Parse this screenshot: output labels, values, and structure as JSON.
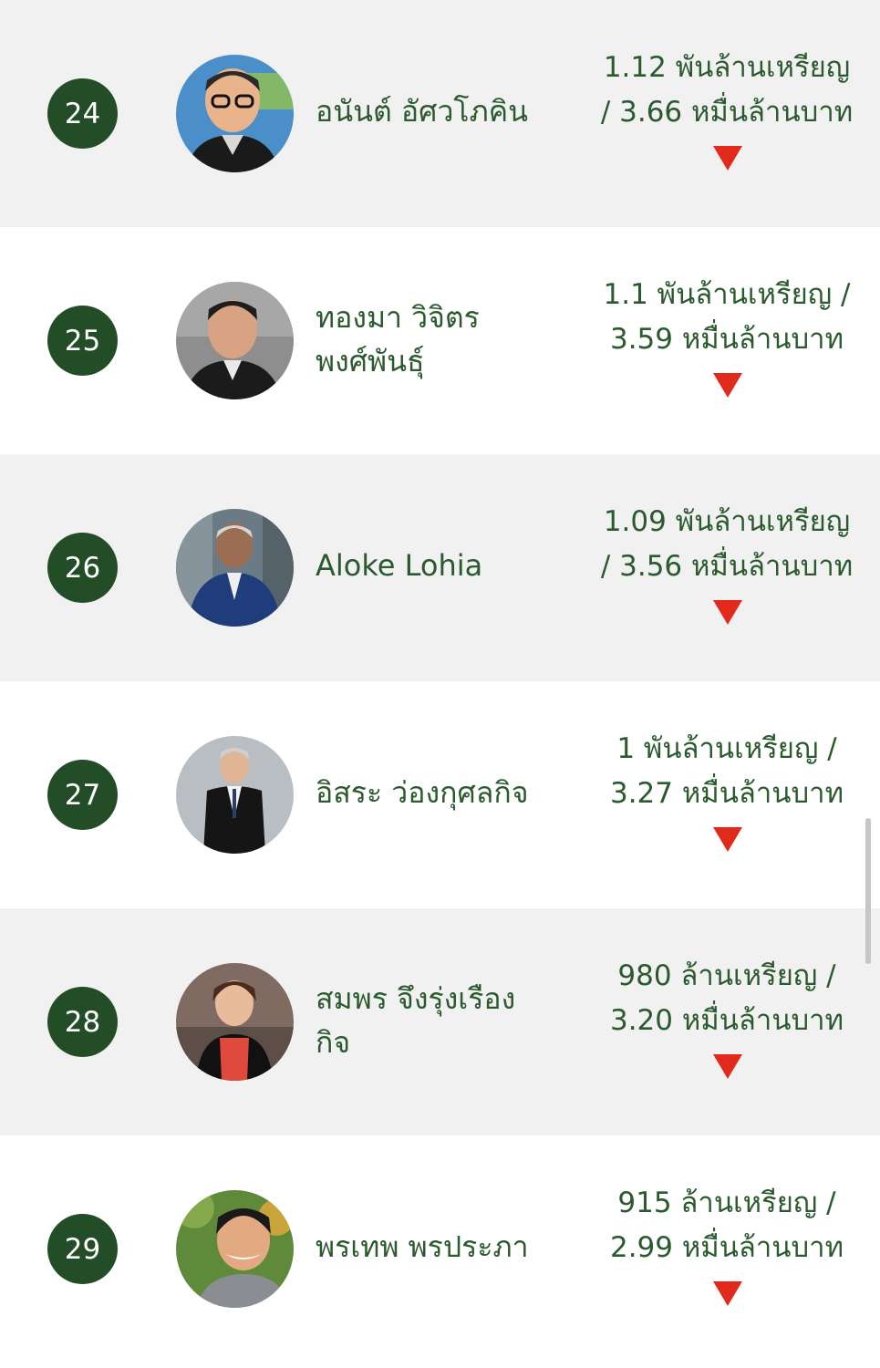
{
  "rows": [
    {
      "rank": "24",
      "name_lines": [
        "อนันต์ อัศวโภคิน",
        ""
      ],
      "wealth_lines": [
        "1.12 พันล้านเหรียญ",
        "/ 3.66 หมื่นล้านบาท"
      ],
      "trend": "down",
      "avatar_colors": {
        "bg": "#4a8fc9",
        "face": "#e9b48c",
        "shirt": "#1a1a1a"
      }
    },
    {
      "rank": "25",
      "name_lines": [
        "ทองมา วิจิตร",
        "พงศ์พันธุ์"
      ],
      "wealth_lines": [
        "1.1 พันล้านเหรียญ /",
        "3.59 หมื่นล้านบาท"
      ],
      "trend": "down",
      "avatar_colors": {
        "bg": "#8e8e8e",
        "face": "#d8a382",
        "shirt": "#1b1b1b"
      }
    },
    {
      "rank": "26",
      "name_lines": [
        "Aloke Lohia",
        ""
      ],
      "wealth_lines": [
        "1.09 พันล้านเหรียญ",
        "/ 3.56 หมื่นล้านบาท"
      ],
      "trend": "down",
      "avatar_colors": {
        "bg": "#6a7b86",
        "face": "#9b6d52",
        "shirt": "#1f3d7a"
      }
    },
    {
      "rank": "27",
      "name_lines": [
        "อิสระ ว่องกุศลกิจ",
        ""
      ],
      "wealth_lines": [
        "1 พันล้านเหรียญ /",
        "3.27 หมื่นล้านบาท"
      ],
      "trend": "down",
      "avatar_colors": {
        "bg": "#b9bec3",
        "face": "#e0b596",
        "shirt": "#151515"
      }
    },
    {
      "rank": "28",
      "name_lines": [
        "สมพร จึงรุ่งเรือง",
        "กิจ"
      ],
      "wealth_lines": [
        "980 ล้านเหรียญ /",
        "3.20 หมื่นล้านบาท"
      ],
      "trend": "down",
      "avatar_colors": {
        "bg": "#7f6b62",
        "face": "#e8bc9b",
        "shirt": "#e04a3c"
      }
    },
    {
      "rank": "29",
      "name_lines": [
        "พรเทพ พรประภา",
        ""
      ],
      "wealth_lines": [
        "915 ล้านเหรียญ /",
        "2.99 หมื่นล้านบาท"
      ],
      "trend": "down",
      "avatar_colors": {
        "bg": "#5e8a3a",
        "face": "#e3a983",
        "shirt": "#8a8d92"
      }
    }
  ],
  "colors": {
    "badge": "#234d26",
    "text": "#2b5a2e",
    "trend_down": "#e12a1c",
    "row_shade": "#f1f1f1",
    "row_plain": "#ffffff"
  },
  "icons": {
    "trend_down": "triangle-down-icon"
  }
}
